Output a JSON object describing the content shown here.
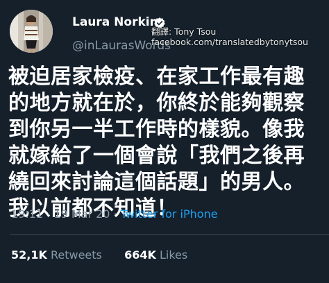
{
  "colors": {
    "background": "#15202b",
    "text_primary": "#ffffff",
    "text_secondary": "#8899a6",
    "link": "#1da1f2",
    "divider": "#38444d",
    "verified_badge": "#ffffff"
  },
  "author": {
    "display_name": "Laura Norkin",
    "handle": "@inLaurasWords",
    "verified": true,
    "avatar_icon": "profile-photo"
  },
  "watermark": {
    "line1": "翻譯: Tony Tsou",
    "line2": "facebook.com/translatedbytonytsou"
  },
  "tweet": {
    "lines": [
      "被迫居家檢疫、在家工作最有趣",
      "的地方就在於，你終於能夠觀察",
      "到你另一半工作時的樣貌。像我",
      "就嫁給了一個會說「我們之後再",
      "繞回來討論這個話題」的男人。",
      "我以前都不知道！"
    ]
  },
  "meta": {
    "time": "19:11",
    "separator": "·",
    "date": "19 Mar 20",
    "source": "Twitter for iPhone"
  },
  "stats": {
    "retweets_value": "52,1K",
    "retweets_label": "Retweets",
    "likes_value": "664K",
    "likes_label": "Likes"
  }
}
